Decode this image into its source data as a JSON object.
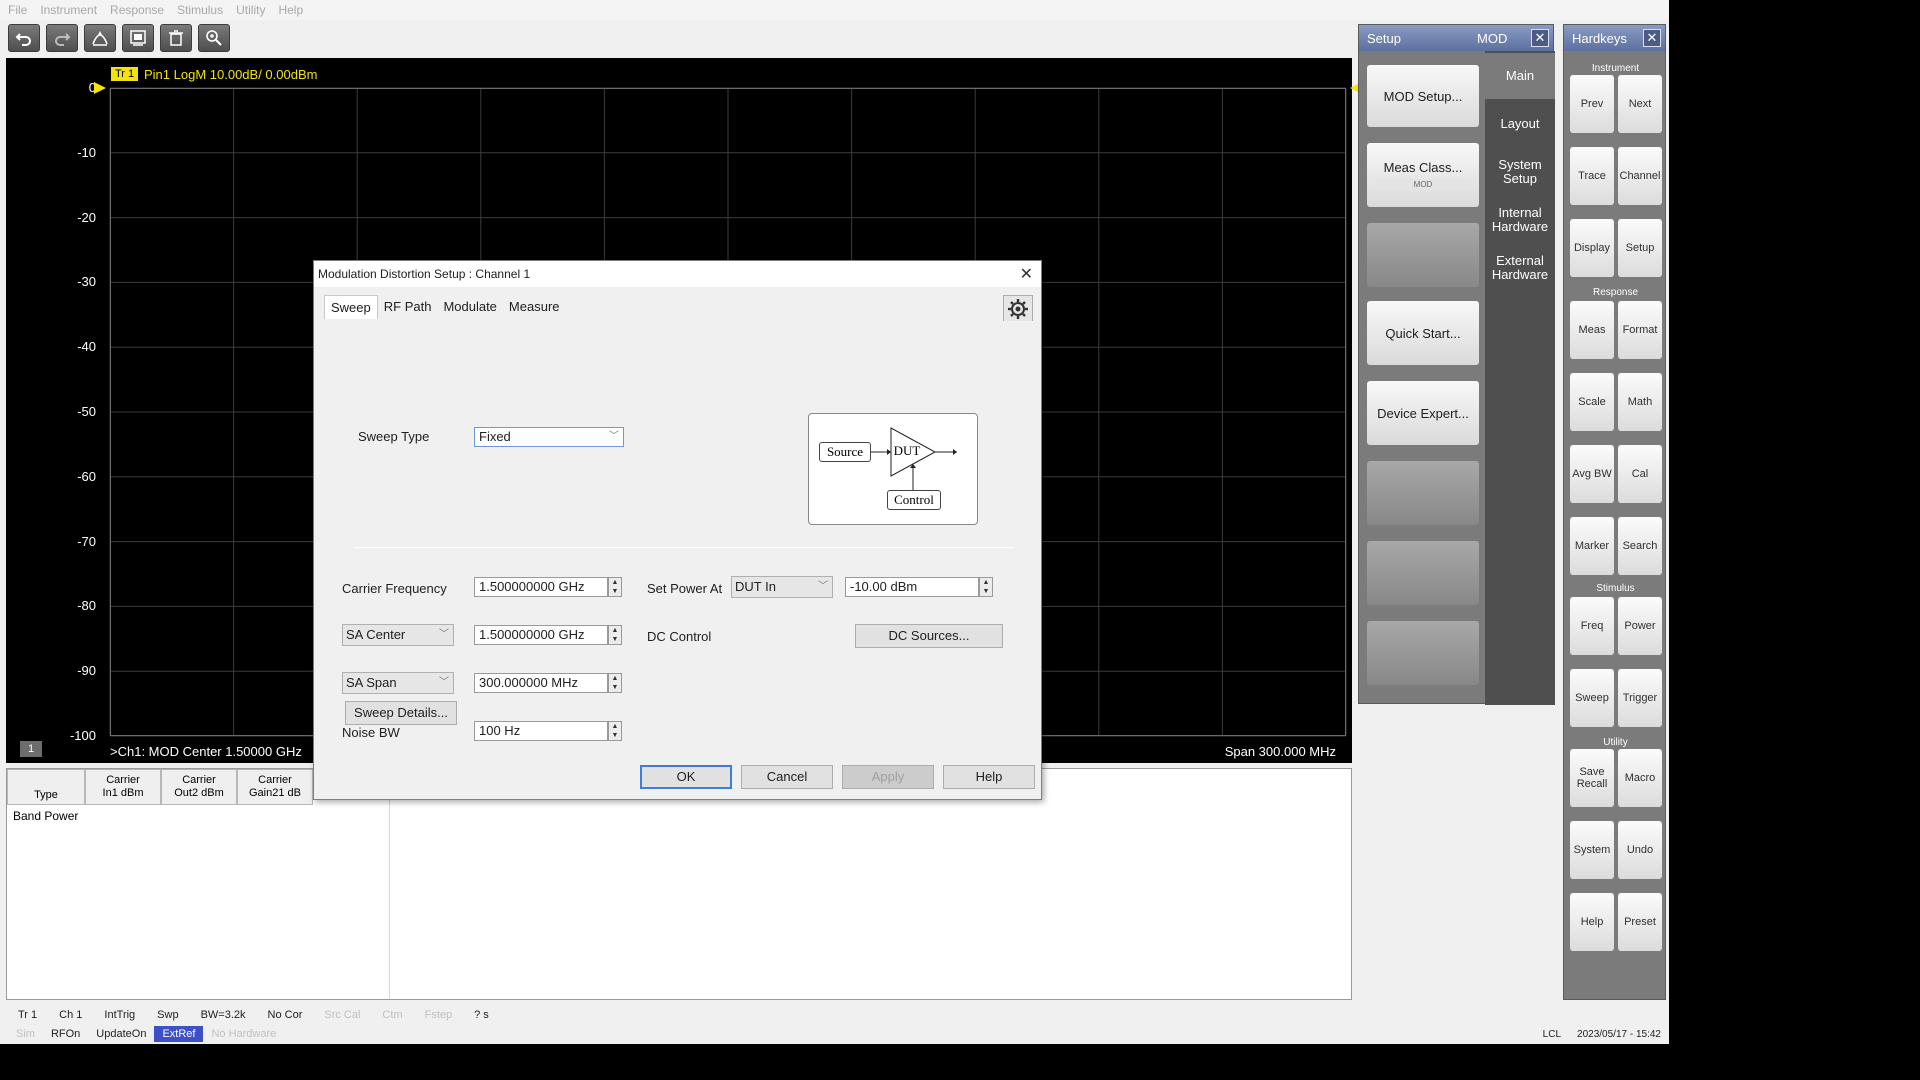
{
  "menu": [
    "File",
    "Instrument",
    "Response",
    "Stimulus",
    "Utility",
    "Help"
  ],
  "toolbar": {
    "icons": [
      "undo-icon",
      "redo-icon",
      "marker-icon",
      "display-icon",
      "delete-icon",
      "zoom-icon"
    ]
  },
  "plot": {
    "trace_badge": "Tr 1",
    "trace_label": "Pin1 LogM 10.00dB/ 0.00dBm",
    "y_ticks": [
      "0",
      "-10",
      "-20",
      "-30",
      "-40",
      "-50",
      "-60",
      "-70",
      "-80",
      "-90",
      "-100"
    ],
    "channel_badge": "1",
    "bottom_left": ">Ch1: MOD  Center  1.50000 GHz",
    "bottom_right": "Span  300.000 MHz",
    "colors": {
      "trace": "#f4e20b",
      "grid": "#3c3c3c",
      "background": "#000000"
    }
  },
  "table": {
    "headers": [
      "Type",
      "Carrier\nIn1 dBm",
      "Carrier\nOut2 dBm",
      "Carrier\nGain21 dB"
    ],
    "rows": [
      "Band Power"
    ]
  },
  "status1": {
    "items": [
      "Tr 1",
      "Ch 1",
      "IntTrig",
      "Swp",
      "BW=3.2k",
      "No Cor"
    ],
    "dim_items": [
      "Src Cal",
      "Ctm",
      "Fstep"
    ],
    "last": "? s"
  },
  "status2": {
    "dim_first": "Sim",
    "items": [
      "RFOn",
      "UpdateOn"
    ],
    "active": "ExtRef",
    "dim_last": "No Hardware",
    "lcl": "LCL",
    "datetime": "2023/05/17 - 15:42"
  },
  "setup_panel": {
    "title": "Setup",
    "mode": "MOD",
    "buttons": [
      {
        "label": "MOD Setup...",
        "sub": ""
      },
      {
        "label": "Meas Class...",
        "sub": "MOD"
      },
      {
        "label": "",
        "sub": ""
      },
      {
        "label": "Quick Start...",
        "sub": ""
      },
      {
        "label": "Device Expert...",
        "sub": ""
      },
      {
        "label": "",
        "sub": ""
      },
      {
        "label": "",
        "sub": ""
      },
      {
        "label": "",
        "sub": ""
      }
    ],
    "tabs": [
      "Main",
      "Layout",
      "System Setup",
      "Internal Hardware",
      "External Hardware"
    ]
  },
  "hardkeys": {
    "title": "Hardkeys",
    "sections": [
      "Instrument",
      "Response",
      "Stimulus",
      "Utility"
    ],
    "keys": [
      "Prev",
      "Next",
      "Trace",
      "Channel",
      "Display",
      "Setup",
      "Meas",
      "Format",
      "Scale",
      "Math",
      "Avg BW",
      "Cal",
      "Marker",
      "Search",
      "Freq",
      "Power",
      "Sweep",
      "Trigger",
      "Save Recall",
      "Macro",
      "System",
      "Undo",
      "Help",
      "Preset"
    ]
  },
  "dialog": {
    "title": "Modulation Distortion Setup : Channel 1",
    "tabs": [
      "Sweep",
      "RF Path",
      "Modulate",
      "Measure"
    ],
    "sweep_type_label": "Sweep Type",
    "sweep_type_value": "Fixed",
    "diagram": {
      "source": "Source",
      "dut": "DUT",
      "control": "Control"
    },
    "carrier_freq_label": "Carrier Frequency",
    "carrier_freq_value": "1.500000000 GHz",
    "set_power_label": "Set Power At",
    "set_power_at": "DUT In",
    "power_value": "-10.00 dBm",
    "sa_center_label": "SA Center",
    "sa_center_value": "1.500000000 GHz",
    "dc_control_label": "DC Control",
    "dc_sources_button": "DC Sources...",
    "sa_span_label": "SA Span",
    "sa_span_value": "300.000000 MHz",
    "noise_bw_label": "Noise BW",
    "noise_bw_value": "100 Hz",
    "sweep_details_button": "Sweep Details...",
    "ok": "OK",
    "cancel": "Cancel",
    "apply": "Apply",
    "help": "Help"
  }
}
